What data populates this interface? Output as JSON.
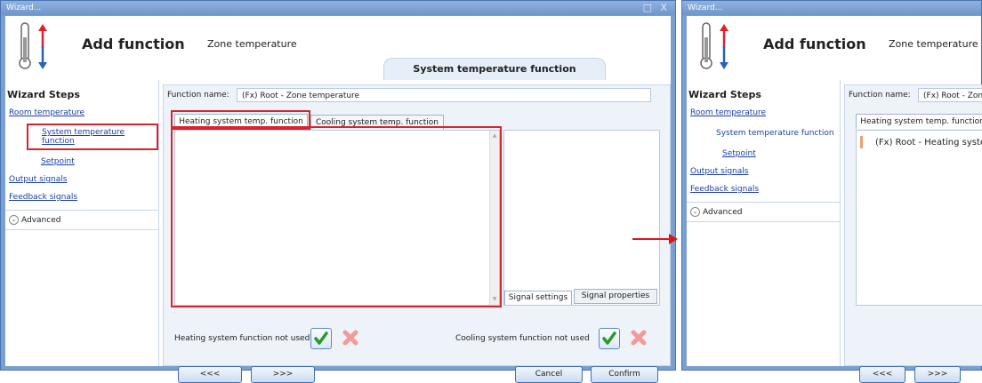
{
  "window": {
    "title": "Wizard...",
    "controls": "□ X"
  },
  "header": {
    "title": "Add function",
    "subtitle": "Zone temperature",
    "step_tab": "System temperature function"
  },
  "sidebar": {
    "heading": "Wizard Steps",
    "items": [
      {
        "label": "Room temperature"
      },
      {
        "label": "System temperature function"
      },
      {
        "label": "Setpoint"
      },
      {
        "label": "Output signals"
      },
      {
        "label": "Feedback signals"
      }
    ],
    "advanced": "Advanced"
  },
  "main": {
    "function_name_label": "Function name:",
    "function_name_value": "(Fx) Root - Zone temperature",
    "tabs": [
      {
        "label": "Heating system temp. function"
      },
      {
        "label": "Cooling system temp. function"
      }
    ],
    "panel_tabs": [
      {
        "label": "Signal settings"
      },
      {
        "label": "Signal properties"
      }
    ],
    "heating_not_used": "Heating system function not used",
    "cooling_not_used": "Cooling system function not used",
    "prev_btn": "<<<",
    "next_btn": ">>>",
    "cancel_btn": "Cancel",
    "confirm_btn": "Confirm"
  },
  "right": {
    "function_name_value": "(Fx) Root - Zone t",
    "tab": "Heating system temp. function",
    "tree_item": "(Fx) Root - Heating syste"
  },
  "colors": {
    "highlight": "#d9232d",
    "accent": "#1a3fa8",
    "arrow": "#e0151b"
  }
}
